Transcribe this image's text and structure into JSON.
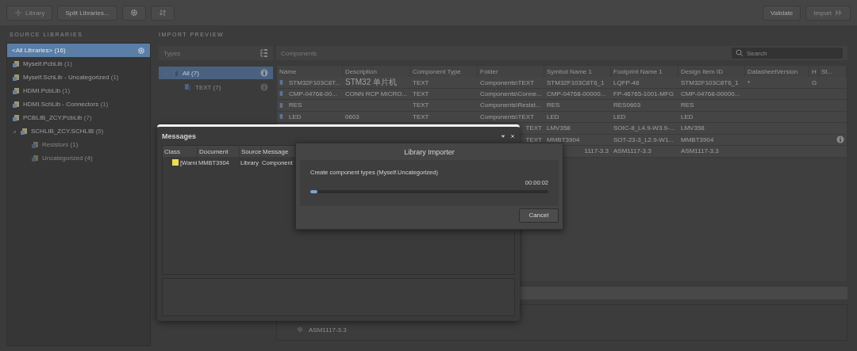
{
  "toolbar": {
    "left_buttons": [
      {
        "label": "Library",
        "kind": "add",
        "disabled": true
      },
      {
        "label": "Split Libraries...",
        "kind": "text",
        "disabled": false
      },
      {
        "kind": "settings",
        "disabled": false
      },
      {
        "kind": "swap",
        "disabled": false
      }
    ],
    "right_buttons": [
      {
        "label": "Validate",
        "kind": "text",
        "disabled": false
      },
      {
        "label": "Import",
        "kind": "forward",
        "disabled": true
      }
    ]
  },
  "source_libraries": {
    "heading": "SOURCE LIBRARIES",
    "items": [
      {
        "name": "<All Libraries>",
        "count": "(16)",
        "kind": "all",
        "selected": true,
        "expanded": false
      },
      {
        "name": "Myself.PcbLib",
        "count": "(1)",
        "kind": "library",
        "selected": false,
        "expanded": false
      },
      {
        "name": "Myself.SchLib - Uncategorized",
        "count": "(1)",
        "kind": "library",
        "selected": false,
        "expanded": false
      },
      {
        "name": "HDMI.PcbLib",
        "count": "(1)",
        "kind": "library",
        "selected": false,
        "expanded": false
      },
      {
        "name": "HDMI.SchLib - Connectors",
        "count": "(1)",
        "kind": "library",
        "selected": false,
        "expanded": false
      },
      {
        "name": "PCBLIB_ZCY.PcbLib",
        "count": "(7)",
        "kind": "library",
        "selected": false,
        "expanded": false
      },
      {
        "name": "SCHLIB_ZCY.SCHLIB",
        "count": "(5)",
        "kind": "library",
        "selected": false,
        "expanded": true,
        "children": [
          {
            "name": "Resistors",
            "count": "(1)",
            "kind": "library",
            "selected": false,
            "disabled": true
          },
          {
            "name": "Uncategorized",
            "count": "(4)",
            "kind": "library",
            "selected": false,
            "disabled": true
          }
        ]
      }
    ]
  },
  "import_preview": {
    "heading": "IMPORT PREVIEW",
    "types": {
      "title": "Types",
      "items": [
        {
          "name": "All (7)",
          "selected": true,
          "expanded": true,
          "children": [
            {
              "name": "TEXT (7)",
              "selected": false
            }
          ]
        }
      ]
    },
    "components": {
      "title": "Components",
      "search": {
        "placeholder": "Search"
      },
      "columns": [
        "Name",
        "Description",
        "Component Type",
        "Folder",
        "Symbol Name 1",
        "Footprint Name 1",
        "Design Item ID",
        "DatasheetVersion",
        "H",
        "St..."
      ],
      "rows": [
        {
          "name": "STM32F103C8T...",
          "description": "STM32 单片机",
          "component_type": "TEXT",
          "folder": "Components\\TEXT",
          "symbol": "STM32F103C8T6_1",
          "footprint": "LQFP-48",
          "design_item_id": "STM32F103C8T6_1",
          "datasheet_version": "*",
          "h": "G",
          "cut": false,
          "status_icon": false
        },
        {
          "name": "CMP-04768-00...",
          "description": "CONN RCP MICRO...",
          "component_type": "TEXT",
          "folder": "Components\\Conne...",
          "symbol": "CMP-04768-00000...",
          "footprint": "FP-46765-1001-MFG",
          "design_item_id": "CMP-04768-00000...",
          "cut": false,
          "status_icon": false
        },
        {
          "name": "RES",
          "component_type": "TEXT",
          "folder": "Components\\Resist...",
          "symbol": "RES",
          "footprint": "RES0603",
          "design_item_id": "RES",
          "cut": false,
          "status_icon": false
        },
        {
          "name": "LED",
          "description": "0603",
          "component_type": "TEXT",
          "folder": "Components\\TEXT",
          "symbol": "LED",
          "footprint": "LED",
          "design_item_id": "LED",
          "cut": false,
          "status_icon": false
        },
        {
          "folder": "TEXT",
          "symbol": "LMV358",
          "footprint": "SOIC-8_L4.9-W3.9-...",
          "design_item_id": "LMV358",
          "cut": true,
          "status_icon": false
        },
        {
          "folder": "TEXT",
          "symbol": "MMBT3904",
          "footprint": "SOT-23-3_L2.9-W1...",
          "design_item_id": "MMBT3904",
          "cut": true,
          "status_icon": true
        },
        {
          "symbol": "1117-3.3",
          "footprint": "ASM1117-3.3",
          "design_item_id": "ASM1117-3.3",
          "cut": true,
          "status_icon": false
        }
      ]
    },
    "lower_items": [
      {
        "name": "ASM1117-3.3"
      }
    ]
  },
  "messages": {
    "title": "Messages",
    "columns": [
      "Class",
      "Document",
      "Source",
      "Message"
    ],
    "rows": [
      {
        "kind": "warning",
        "class": "[Warni",
        "document": "MMBT3904",
        "source": "Library",
        "message": "Component"
      }
    ]
  },
  "importer": {
    "title": "Library Importer",
    "status": "Create component types (Myself.Uncategorized)",
    "elapsed": "00:00:02",
    "level": 0.03,
    "cancel": "Cancel"
  }
}
